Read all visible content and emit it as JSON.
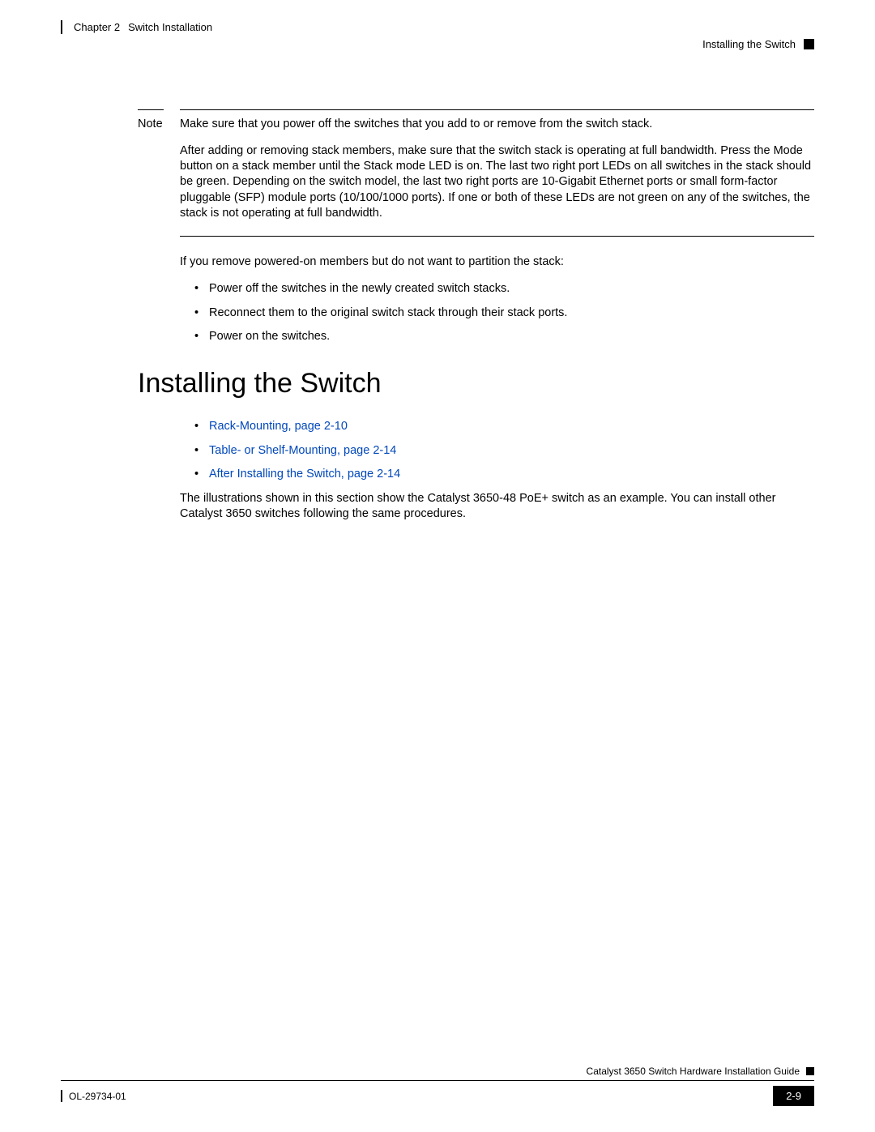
{
  "header": {
    "chapter": "Chapter 2",
    "chapterTitle": "Switch Installation",
    "sectionTitle": "Installing the Switch"
  },
  "note": {
    "label": "Note",
    "paragraphs": [
      "Make sure that you power off the switches that you add to or remove from the switch stack.",
      "After adding or removing stack members, make sure that the switch stack is operating at full bandwidth. Press the Mode button on a stack member until the Stack mode LED is on. The last two right port LEDs on all switches in the stack should be green. Depending on the switch model, the last two right ports are 10-Gigabit Ethernet ports or small form-factor pluggable (SFP) module ports (10/100/1000 ports). If one or both of these LEDs are not green on any of the switches, the stack is not operating at full bandwidth."
    ]
  },
  "afterNote": {
    "intro": "If you remove powered-on members but do not want to partition the stack:",
    "bullets": [
      "Power off the switches in the newly created switch stacks.",
      "Reconnect them to the original switch stack through their stack ports.",
      "Power on the switches."
    ]
  },
  "section": {
    "heading": "Installing the Switch",
    "linkBullets": [
      "Rack-Mounting, page 2-10",
      "Table- or Shelf-Mounting, page 2-14",
      "After Installing the Switch, page 2-14"
    ],
    "paragraph": "The illustrations shown in this section show the Catalyst 3650-48 PoE+ switch as an example. You can install other Catalyst 3650 switches following the same procedures."
  },
  "footer": {
    "guideTitle": "Catalyst 3650 Switch Hardware Installation Guide",
    "docId": "OL-29734-01",
    "pageNum": "2-9"
  }
}
